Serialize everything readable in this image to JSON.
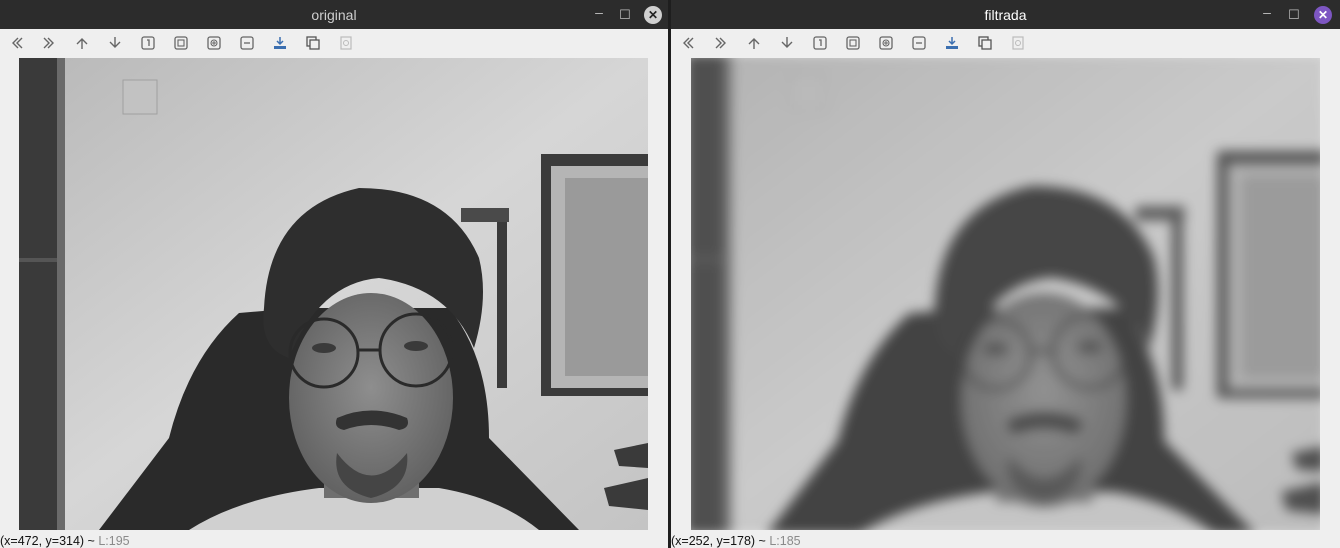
{
  "windows": [
    {
      "title": "original",
      "status": {
        "coords": "(x=472, y=314) ~",
        "lum": "L:195"
      }
    },
    {
      "title": "filtrada",
      "status": {
        "coords": "(x=252, y=178) ~",
        "lum": "L:185"
      }
    }
  ],
  "window_controls": {
    "minimize": "–",
    "maximize": "☐",
    "close": "✕"
  },
  "toolbar": [
    {
      "icon": "back-icon"
    },
    {
      "icon": "forward-icon"
    },
    {
      "icon": "pan-up-icon"
    },
    {
      "icon": "pan-down-icon"
    },
    {
      "icon": "zoom-reset-icon"
    },
    {
      "icon": "zoom-fit-icon"
    },
    {
      "icon": "zoom-in-icon"
    },
    {
      "icon": "zoom-out-icon"
    },
    {
      "icon": "save-image-icon"
    },
    {
      "icon": "copy-image-icon"
    },
    {
      "icon": "properties-icon"
    }
  ]
}
